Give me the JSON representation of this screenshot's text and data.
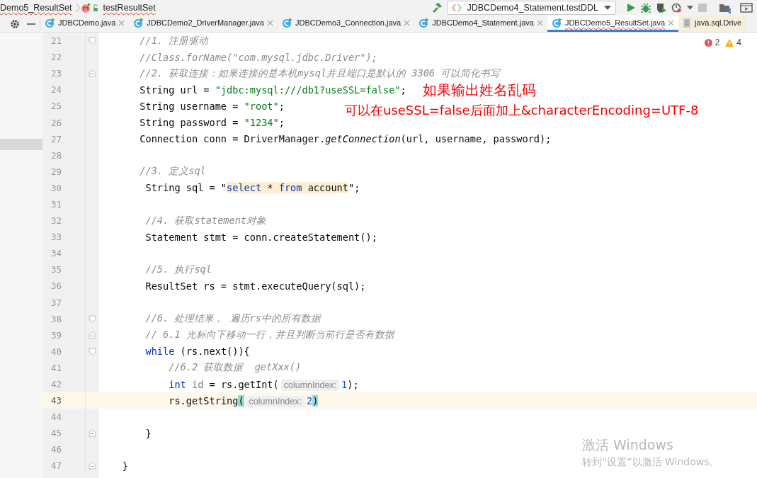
{
  "breadcrumb": [
    {
      "text": "Demo5_ResultSet",
      "kind": "class",
      "error": true
    },
    {
      "text": "testResultSet",
      "kind": "method",
      "error": true
    }
  ],
  "toolbar": {
    "run_config": "JDBCDemo4_Statement.testDDL"
  },
  "tabs": [
    {
      "label": "JDBCDemo.java",
      "kind": "class",
      "selected": false,
      "error": false,
      "closable": true
    },
    {
      "label": "JDBCDemo2_DriverManager.java",
      "kind": "class",
      "selected": false,
      "error": false,
      "closable": true
    },
    {
      "label": "JDBCDemo3_Connection.java",
      "kind": "class",
      "selected": false,
      "error": false,
      "closable": true
    },
    {
      "label": "JDBCDemo4_Statement.java",
      "kind": "class",
      "selected": false,
      "error": false,
      "closable": true
    },
    {
      "label": "JDBCDemo5_ResultSet.java",
      "kind": "class",
      "selected": true,
      "error": true,
      "closable": true
    },
    {
      "label": "java.sql.Drive",
      "kind": "library",
      "selected": false,
      "error": false,
      "closable": false
    }
  ],
  "inspections": {
    "errors": "2",
    "warnings": "4"
  },
  "lines": [
    {
      "number": "21",
      "fold_start": true,
      "fold_end": false,
      "current": false,
      "segments": [
        {
          "kind": "comment",
          "text": "       //1. 注册驱动"
        }
      ]
    },
    {
      "number": "22",
      "fold_start": false,
      "fold_end": false,
      "current": false,
      "segments": [
        {
          "kind": "comment",
          "text": "       //Class.forName(\"com.mysql.jdbc.Driver\");"
        }
      ]
    },
    {
      "number": "23",
      "fold_start": false,
      "fold_end": true,
      "current": false,
      "segments": [
        {
          "kind": "comment",
          "text": "       //2. 获取连接：如果连接的是本机mysql并且端口是默认的 3306 可以简化书写"
        }
      ]
    },
    {
      "number": "24",
      "fold_start": false,
      "fold_end": false,
      "current": false,
      "segments": [
        {
          "kind": "plain",
          "text": "       String url = "
        },
        {
          "kind": "string",
          "text": "\"jdbc:mysql:///db1?useSSL=false\""
        },
        {
          "kind": "plain",
          "text": ";"
        }
      ]
    },
    {
      "number": "25",
      "fold_start": false,
      "fold_end": false,
      "current": false,
      "segments": [
        {
          "kind": "plain",
          "text": "       String username = "
        },
        {
          "kind": "string",
          "text": "\"root\""
        },
        {
          "kind": "plain",
          "text": ";"
        }
      ]
    },
    {
      "number": "26",
      "fold_start": false,
      "fold_end": false,
      "current": false,
      "segments": [
        {
          "kind": "plain",
          "text": "       String password = "
        },
        {
          "kind": "string",
          "text": "\"1234\""
        },
        {
          "kind": "plain",
          "text": ";"
        }
      ]
    },
    {
      "number": "27",
      "fold_start": false,
      "fold_end": false,
      "current": false,
      "segments": [
        {
          "kind": "plain",
          "text": "       Connection conn = DriverManager."
        },
        {
          "kind": "italic",
          "text": "getConnection"
        },
        {
          "kind": "plain",
          "text": "(url, username, password);"
        }
      ]
    },
    {
      "number": "28",
      "fold_start": false,
      "fold_end": false,
      "current": false
    },
    {
      "number": "29",
      "fold_start": false,
      "fold_end": false,
      "current": false,
      "segments": [
        {
          "kind": "comment",
          "text": "       //3. 定义sql"
        }
      ]
    },
    {
      "number": "30",
      "fold_start": false,
      "fold_end": false,
      "current": false,
      "segments": [
        {
          "kind": "plain",
          "text": "        String sql = \""
        },
        {
          "kind": "sqlkw",
          "text": "select"
        },
        {
          "kind": "sql",
          "text": " * "
        },
        {
          "kind": "sqlkw",
          "text": "from"
        },
        {
          "kind": "sql",
          "text": " account"
        },
        {
          "kind": "plain",
          "text": "\";"
        }
      ]
    },
    {
      "number": "31",
      "fold_start": false,
      "fold_end": false,
      "current": false
    },
    {
      "number": "32",
      "fold_start": false,
      "fold_end": false,
      "current": false,
      "segments": [
        {
          "kind": "comment",
          "text": "        //4. 获取statement对象"
        }
      ]
    },
    {
      "number": "33",
      "fold_start": false,
      "fold_end": false,
      "current": false,
      "segments": [
        {
          "kind": "plain",
          "text": "        Statement stmt = conn.createStatement();"
        }
      ]
    },
    {
      "number": "34",
      "fold_start": false,
      "fold_end": false,
      "current": false
    },
    {
      "number": "35",
      "fold_start": false,
      "fold_end": false,
      "current": false,
      "segments": [
        {
          "kind": "comment",
          "text": "        //5. 执行sql"
        }
      ]
    },
    {
      "number": "36",
      "fold_start": false,
      "fold_end": false,
      "current": false,
      "segments": [
        {
          "kind": "plain",
          "text": "        ResultSet rs = stmt.executeQuery(sql);"
        }
      ]
    },
    {
      "number": "37",
      "fold_start": false,
      "fold_end": false,
      "current": false
    },
    {
      "number": "38",
      "fold_start": true,
      "fold_end": false,
      "current": false,
      "segments": [
        {
          "kind": "comment",
          "text": "        //6. 处理结果， 遍历rs中的所有数据"
        }
      ]
    },
    {
      "number": "39",
      "fold_start": false,
      "fold_end": true,
      "current": false,
      "segments": [
        {
          "kind": "comment",
          "text": "        // 6.1 光标向下移动一行，并且判断当前行是否有数据"
        }
      ]
    },
    {
      "number": "40",
      "fold_start": true,
      "fold_end": false,
      "current": false,
      "segments": [
        {
          "kind": "keyword",
          "text": "        while"
        },
        {
          "kind": "plain",
          "text": " (rs.next()){"
        }
      ]
    },
    {
      "number": "41",
      "fold_start": false,
      "fold_end": false,
      "current": false,
      "segments": [
        {
          "kind": "comment",
          "text": "            //6.2 获取数据  getXxx()"
        }
      ]
    },
    {
      "number": "42",
      "fold_start": false,
      "fold_end": false,
      "current": false,
      "segments": [
        {
          "kind": "keyword",
          "text": "            int"
        },
        {
          "kind": "unused",
          "text": " id"
        },
        {
          "kind": "plain",
          "text": " = rs.getInt("
        },
        {
          "kind": "hint",
          "text": "columnIndex:"
        },
        {
          "kind": "number",
          "text": "1"
        },
        {
          "kind": "plain",
          "text": ");"
        }
      ]
    },
    {
      "number": "43",
      "fold_start": false,
      "fold_end": false,
      "current": true,
      "segments": [
        {
          "kind": "plain",
          "text": "            rs.getString"
        },
        {
          "kind": "match",
          "text": "("
        },
        {
          "kind": "hint",
          "text": "columnIndex:"
        },
        {
          "kind": "number",
          "text": "2"
        },
        {
          "kind": "match",
          "text": ")"
        }
      ]
    },
    {
      "number": "44",
      "fold_start": false,
      "fold_end": false,
      "current": false
    },
    {
      "number": "45",
      "fold_start": false,
      "fold_end": true,
      "current": false,
      "segments": [
        {
          "kind": "plain",
          "text": "        }"
        }
      ]
    },
    {
      "number": "46",
      "fold_start": false,
      "fold_end": false,
      "current": false
    },
    {
      "number": "47",
      "fold_start": false,
      "fold_end": true,
      "current": false,
      "segments": [
        {
          "kind": "plain",
          "text": "    }"
        }
      ]
    }
  ],
  "annotations": [
    {
      "text": "如果输出姓名乱码"
    },
    {
      "text": "可以在useSSL=false后面加上&characterEncoding=UTF-8"
    }
  ],
  "os_notice": {
    "title": "激活 Windows",
    "subtitle": "转到“设置”以激活 Windows。"
  }
}
